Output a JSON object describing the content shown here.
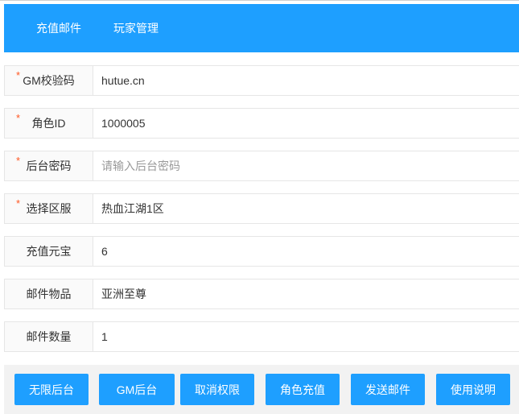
{
  "nav": {
    "tabs": [
      {
        "label": "充值邮件"
      },
      {
        "label": "玩家管理"
      }
    ]
  },
  "form": {
    "rows": [
      {
        "label": "GM校验码",
        "required": true,
        "value": "hutue.cn",
        "placeholder": ""
      },
      {
        "label": "角色ID",
        "required": true,
        "value": "1000005",
        "placeholder": ""
      },
      {
        "label": "后台密码",
        "required": true,
        "value": "",
        "placeholder": "请输入后台密码"
      },
      {
        "label": "选择区服",
        "required": true,
        "value": "热血江湖1区",
        "placeholder": ""
      },
      {
        "label": "充值元宝",
        "required": false,
        "value": "6",
        "placeholder": ""
      },
      {
        "label": "邮件物品",
        "required": false,
        "value": "亚洲至尊",
        "placeholder": ""
      },
      {
        "label": "邮件数量",
        "required": false,
        "value": "1",
        "placeholder": ""
      }
    ]
  },
  "buttons": [
    {
      "label": "无限后台"
    },
    {
      "label": "GM后台"
    },
    {
      "label": "取消权限"
    },
    {
      "label": "角色充值"
    },
    {
      "label": "发送邮件"
    },
    {
      "label": "使用说明"
    }
  ],
  "required_mark": "*",
  "colors": {
    "primary": "#1e9fff",
    "required": "#ff5722",
    "button_bar_bg": "#f2f2f2"
  }
}
